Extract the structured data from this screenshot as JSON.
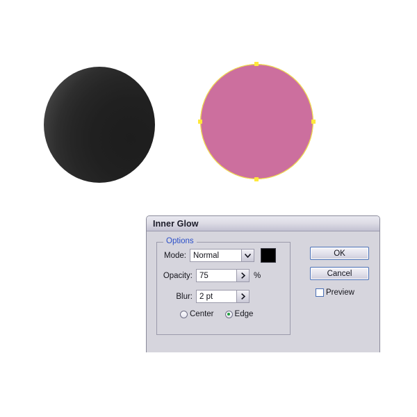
{
  "canvas": {
    "dark_circle": {
      "name": "dark sphere with inner glow applied",
      "fill_color": "#1d1d1d",
      "glow_edge_color": "#636363"
    },
    "pink_circle": {
      "name": "selected pink circle",
      "fill_color": "#cc6f9e",
      "path_color": "#f2e24a",
      "anchor_color": "#ffe93a",
      "anchor_count": 4
    }
  },
  "dialog": {
    "title": "Inner Glow",
    "options_group": {
      "legend": "Options",
      "mode": {
        "label": "Mode:",
        "value": "Normal",
        "arrow_icon": "chevron-down-icon",
        "swatch_color": "#000000"
      },
      "opacity": {
        "label": "Opacity:",
        "value": "75",
        "unit": "%",
        "arrow_icon": "chevron-right-icon"
      },
      "blur": {
        "label": "Blur:",
        "value": "2 pt",
        "arrow_icon": "chevron-right-icon"
      },
      "radios": [
        {
          "label": "Center",
          "selected": false
        },
        {
          "label": "Edge",
          "selected": true
        }
      ],
      "radio_selected_color": "#1f9e3c"
    },
    "buttons": {
      "ok": "OK",
      "cancel": "Cancel"
    },
    "preview": {
      "label": "Preview",
      "checked": false
    }
  }
}
